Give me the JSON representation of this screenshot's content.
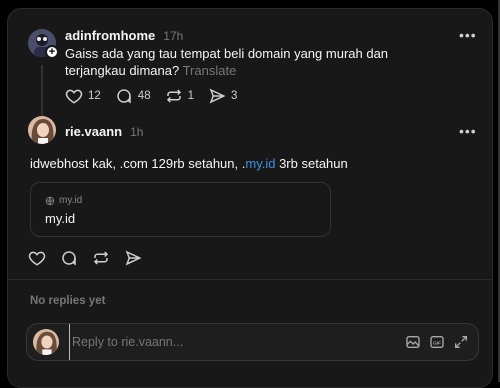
{
  "post": {
    "username": "adinfromhome",
    "time": "17h",
    "text": "Gaiss ada yang tau tempat beli domain yang murah dan terjangkau dimana?",
    "translate": "Translate",
    "likes": "12",
    "comments": "48",
    "reposts": "1",
    "shares": "3",
    "more": "•••"
  },
  "reply": {
    "username": "rie.vaann",
    "time": "1h",
    "text_before": "idwebhost kak, .com 129rb setahun, .",
    "link_text": "my.id",
    "text_after": " 3rb setahun",
    "more": "•••",
    "card": {
      "domain": "my.id",
      "title": "my.id"
    }
  },
  "footer": {
    "no_replies": "No replies yet",
    "reply_placeholder": "Reply to rie.vaann..."
  },
  "colors": {
    "background": "#181818",
    "text": "#f3f5f7",
    "muted": "#777777",
    "link": "#3c8fe8"
  },
  "icons": [
    "heart-icon",
    "comment-icon",
    "repost-icon",
    "share-icon",
    "globe-icon",
    "image-icon",
    "gif-icon",
    "expand-icon",
    "follow-plus-icon"
  ]
}
